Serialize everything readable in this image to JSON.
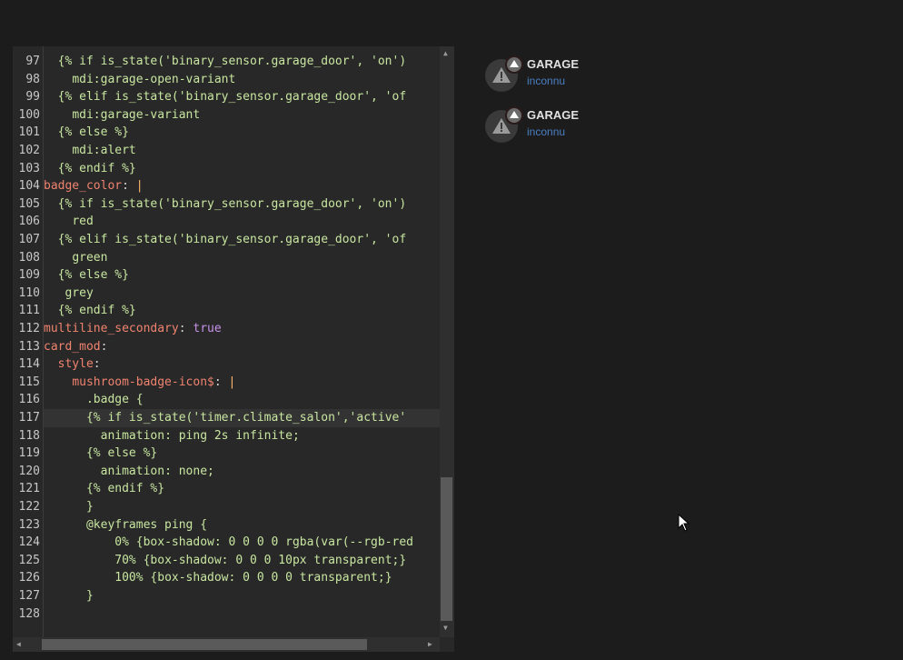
{
  "editor": {
    "lines": [
      {
        "n": "97",
        "segs": [
          {
            "t": "  ",
            "c": ""
          },
          {
            "t": "{% if is_state('binary_sensor.garage_door', 'on')",
            "c": "tpl"
          }
        ]
      },
      {
        "n": "98",
        "segs": [
          {
            "t": "    ",
            "c": ""
          },
          {
            "t": "mdi:garage-open-variant",
            "c": "tpl"
          }
        ]
      },
      {
        "n": "99",
        "segs": [
          {
            "t": "  ",
            "c": ""
          },
          {
            "t": "{% elif is_state('binary_sensor.garage_door', 'of",
            "c": "tpl"
          }
        ]
      },
      {
        "n": "100",
        "segs": [
          {
            "t": "    ",
            "c": ""
          },
          {
            "t": "mdi:garage-variant",
            "c": "tpl"
          }
        ]
      },
      {
        "n": "101",
        "segs": [
          {
            "t": "  ",
            "c": ""
          },
          {
            "t": "{% else %}",
            "c": "tpl"
          }
        ]
      },
      {
        "n": "102",
        "segs": [
          {
            "t": "    ",
            "c": ""
          },
          {
            "t": "mdi:alert",
            "c": "tpl"
          }
        ]
      },
      {
        "n": "103",
        "segs": [
          {
            "t": "  ",
            "c": ""
          },
          {
            "t": "{% endif %}",
            "c": "tpl"
          }
        ]
      },
      {
        "n": "104",
        "segs": [
          {
            "t": "badge_color",
            "c": "key"
          },
          {
            "t": ": ",
            "c": ""
          },
          {
            "t": "|",
            "c": "pipe"
          }
        ]
      },
      {
        "n": "105",
        "segs": [
          {
            "t": "  ",
            "c": ""
          },
          {
            "t": "{% if is_state('binary_sensor.garage_door', 'on')",
            "c": "tpl"
          }
        ]
      },
      {
        "n": "106",
        "segs": [
          {
            "t": "    ",
            "c": ""
          },
          {
            "t": "red",
            "c": "tpl"
          }
        ]
      },
      {
        "n": "107",
        "segs": [
          {
            "t": "  ",
            "c": ""
          },
          {
            "t": "{% elif is_state('binary_sensor.garage_door', 'of",
            "c": "tpl"
          }
        ]
      },
      {
        "n": "108",
        "segs": [
          {
            "t": "    ",
            "c": ""
          },
          {
            "t": "green",
            "c": "tpl"
          }
        ]
      },
      {
        "n": "109",
        "segs": [
          {
            "t": "  ",
            "c": ""
          },
          {
            "t": "{% else %}",
            "c": "tpl"
          }
        ]
      },
      {
        "n": "110",
        "segs": [
          {
            "t": "   ",
            "c": ""
          },
          {
            "t": "grey",
            "c": "tpl"
          }
        ]
      },
      {
        "n": "111",
        "segs": [
          {
            "t": "  ",
            "c": ""
          },
          {
            "t": "{% endif %}",
            "c": "tpl"
          }
        ]
      },
      {
        "n": "112",
        "segs": [
          {
            "t": "multiline_secondary",
            "c": "key"
          },
          {
            "t": ": ",
            "c": ""
          },
          {
            "t": "true",
            "c": "bool"
          }
        ]
      },
      {
        "n": "113",
        "segs": [
          {
            "t": "card_mod",
            "c": "key"
          },
          {
            "t": ":",
            "c": ""
          }
        ]
      },
      {
        "n": "114",
        "segs": [
          {
            "t": "  ",
            "c": ""
          },
          {
            "t": "style",
            "c": "key"
          },
          {
            "t": ":",
            "c": ""
          }
        ]
      },
      {
        "n": "115",
        "segs": [
          {
            "t": "    ",
            "c": ""
          },
          {
            "t": "mushroom-badge-icon$",
            "c": "key"
          },
          {
            "t": ": ",
            "c": ""
          },
          {
            "t": "|",
            "c": "pipe"
          }
        ]
      },
      {
        "n": "116",
        "segs": [
          {
            "t": "      ",
            "c": ""
          },
          {
            "t": ".badge {",
            "c": "tpl"
          }
        ]
      },
      {
        "n": "117",
        "segs": [
          {
            "t": "      ",
            "c": ""
          },
          {
            "t": "{% if is_state('timer.climate_salon','active'",
            "c": "tpl"
          }
        ],
        "active": true
      },
      {
        "n": "118",
        "segs": [
          {
            "t": "        ",
            "c": ""
          },
          {
            "t": "animation: ping 2s infinite;",
            "c": "tpl"
          }
        ]
      },
      {
        "n": "119",
        "segs": [
          {
            "t": "      ",
            "c": ""
          },
          {
            "t": "{% else %}",
            "c": "tpl"
          }
        ]
      },
      {
        "n": "120",
        "segs": [
          {
            "t": "        ",
            "c": ""
          },
          {
            "t": "animation: none;",
            "c": "tpl"
          }
        ]
      },
      {
        "n": "121",
        "segs": [
          {
            "t": "      ",
            "c": ""
          },
          {
            "t": "{% endif %}",
            "c": "tpl"
          }
        ]
      },
      {
        "n": "122",
        "segs": [
          {
            "t": "      ",
            "c": ""
          },
          {
            "t": "}",
            "c": "tpl"
          }
        ]
      },
      {
        "n": "123",
        "segs": [
          {
            "t": "      ",
            "c": ""
          },
          {
            "t": "@keyframes ping {",
            "c": "tpl"
          }
        ]
      },
      {
        "n": "124",
        "segs": [
          {
            "t": "          ",
            "c": ""
          },
          {
            "t": "0% {box-shadow: 0 0 0 0 rgba(var(--rgb-red",
            "c": "tpl"
          }
        ]
      },
      {
        "n": "125",
        "segs": [
          {
            "t": "          ",
            "c": ""
          },
          {
            "t": "70% {box-shadow: 0 0 0 10px transparent;}",
            "c": "tpl"
          }
        ]
      },
      {
        "n": "126",
        "segs": [
          {
            "t": "          ",
            "c": ""
          },
          {
            "t": "100% {box-shadow: 0 0 0 0 transparent;}",
            "c": "tpl"
          }
        ]
      },
      {
        "n": "127",
        "segs": [
          {
            "t": "      ",
            "c": ""
          },
          {
            "t": "}",
            "c": "tpl"
          }
        ]
      },
      {
        "n": "128",
        "segs": []
      }
    ]
  },
  "badges": [
    {
      "title": "GARAGE",
      "subtitle": "inconnu",
      "icon": "alert-icon"
    },
    {
      "title": "GARAGE",
      "subtitle": "inconnu",
      "icon": "alert-icon"
    }
  ],
  "colors": {
    "template": "#c8e6a0",
    "key": "#f0836f",
    "bool": "#c792ea",
    "subtitle": "#4a7fc4"
  }
}
